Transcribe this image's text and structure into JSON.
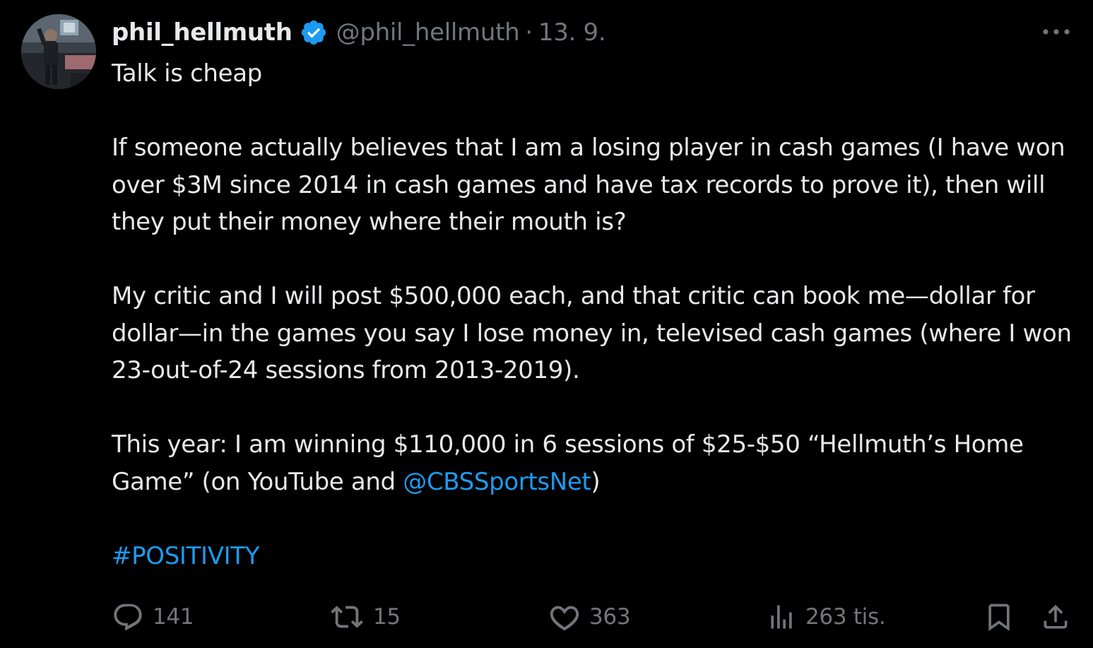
{
  "author": {
    "display_name": "phil_hellmuth",
    "handle": "@phil_hellmuth",
    "separator": "·",
    "date": "13. 9.",
    "verified": true
  },
  "tweet": {
    "line1": "Talk is cheap",
    "para2": "If someone actually believes that I am a losing player in cash games (I have won over $3M since 2014 in cash games and have tax records to prove it), then will they put their money where their mouth is?",
    "para3": "My critic and I will post $500,000 each, and that critic can book me—dollar for dollar—in the games you say I lose money in, televised cash games (where I won 23-out-of-24 sessions from 2013-2019).",
    "para4_before": "This year: I am winning $110,000 in 6 sessions of $25-$50 “Hellmuth’s Home Game” (on YouTube and ",
    "mention": "@CBSSportsNet",
    "para4_after": ")",
    "hashtag": "#POSITIVITY"
  },
  "actions": {
    "reply_count": "141",
    "retweet_count": "15",
    "like_count": "363",
    "views_count": "263 tis."
  },
  "colors": {
    "background": "#000000",
    "text": "#e7e9ea",
    "muted": "#71767b",
    "link": "#1d9bf0",
    "verified": "#1d9bf0"
  },
  "icons": [
    "more-icon",
    "verified-icon",
    "reply-icon",
    "retweet-icon",
    "like-icon",
    "views-icon",
    "bookmark-icon",
    "share-icon"
  ]
}
